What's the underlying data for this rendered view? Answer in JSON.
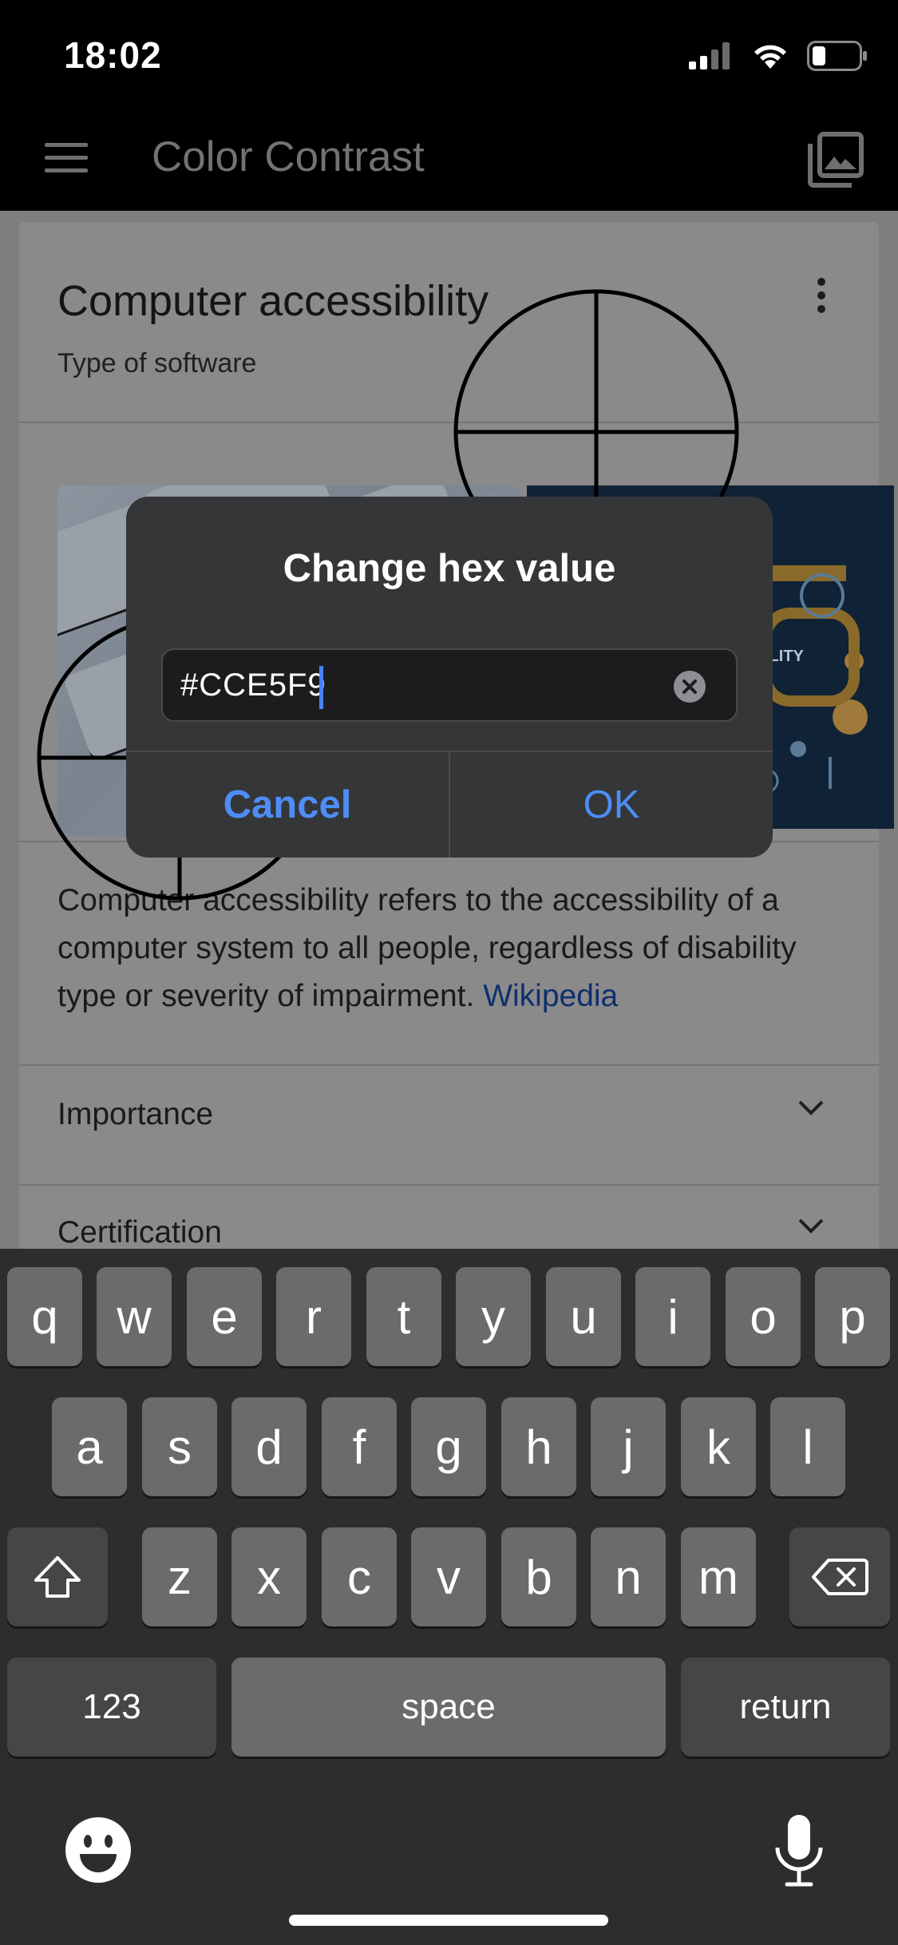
{
  "status_bar": {
    "time": "18:02"
  },
  "app_bar": {
    "title": "Color Contrast"
  },
  "card": {
    "title": "Computer accessibility",
    "subtitle": "Type of software",
    "description": "Computer accessibility refers to the accessibility of a computer system to all people, regardless of disability type or severity of impairment. ",
    "link": "Wikipedia",
    "image_badge": "ILITY",
    "rows": [
      {
        "label": "Importance"
      },
      {
        "label": "Certification"
      }
    ]
  },
  "dialog": {
    "title": "Change hex value",
    "hex_value": "#CCE5F9",
    "cancel_label": "Cancel",
    "ok_label": "OK"
  },
  "keyboard": {
    "row1": [
      "q",
      "w",
      "e",
      "r",
      "t",
      "y",
      "u",
      "i",
      "o",
      "p"
    ],
    "row2": [
      "a",
      "s",
      "d",
      "f",
      "g",
      "h",
      "j",
      "k",
      "l"
    ],
    "row3": [
      "z",
      "x",
      "c",
      "v",
      "b",
      "n",
      "m"
    ],
    "numbers_label": "123",
    "space_label": "space",
    "return_label": "return"
  },
  "colors": {
    "accent": "#4E8DF7",
    "caret": "#4A80FF",
    "link": "#0F2F6E"
  }
}
